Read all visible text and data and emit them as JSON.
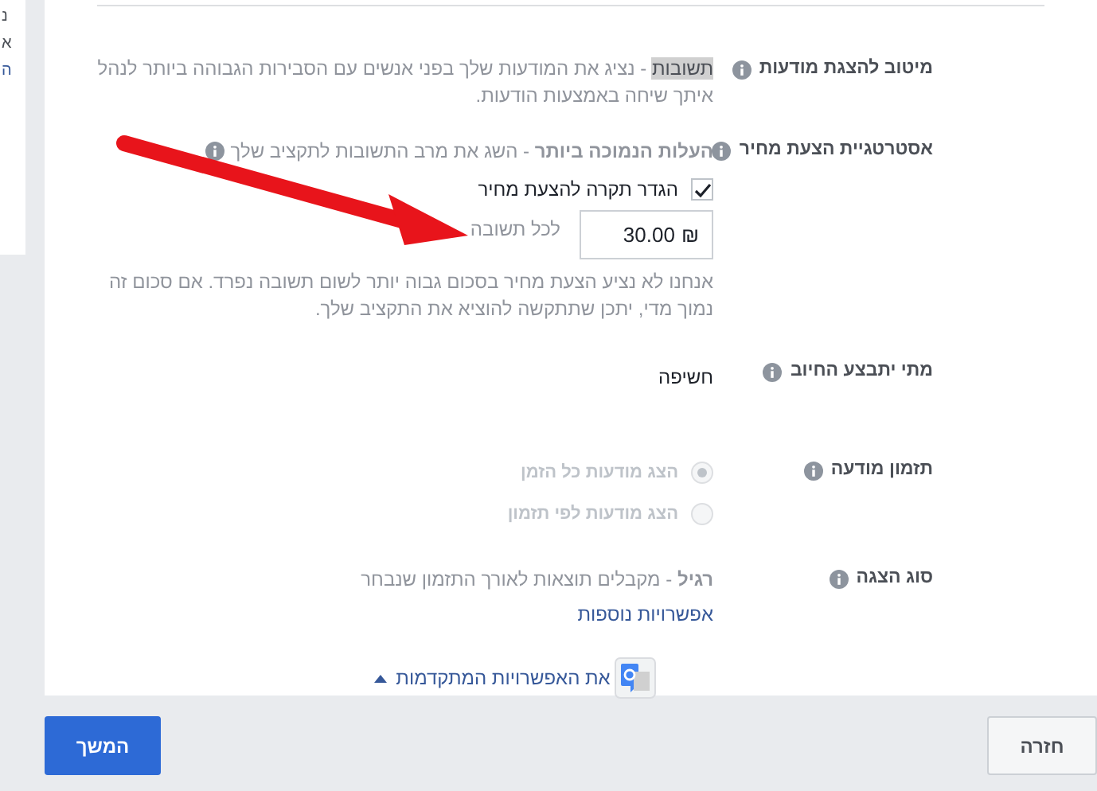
{
  "side_panel": {
    "lines": [
      {
        "text": "נ",
        "kind": "plain"
      },
      {
        "text": "א",
        "kind": "plain"
      },
      {
        "text": "ה",
        "kind": "link"
      }
    ]
  },
  "rows": [
    {
      "kind": "description",
      "label": "מיטוב להצגת מודעות",
      "term": "תשובות",
      "text": "- נציג את המודעות שלך בפני אנשים עם הסבירות הגבוהה ביותר לנהל איתך שיחה באמצעות הודעות."
    },
    {
      "kind": "bid",
      "label": "אסטרטגיית הצעת מחיר",
      "text": "**העלות הנמוכה ביותר** - השג את מרב התשובות לתקציב שלך",
      "cap": {
        "label": "הגדר תקרה להצעת מחיר",
        "checked": true
      },
      "amount": {
        "value": "30.00",
        "currency": "₪",
        "unit": "לכל תשובה"
      },
      "help": "אנחנו לא נציע הצעת מחיר בסכום גבוה יותר לשום תשובה נפרד. אם סכום זה נמוך מדי, יתכן שתתקשה להוציא את התקציב שלך."
    },
    {
      "kind": "value",
      "label": "מתי יתבצע החיוב",
      "text": "חשיפה"
    },
    {
      "kind": "radios",
      "label": "תזמון מודעה",
      "options": [
        {
          "label": "הצג מודעות כל הזמן",
          "selected": true,
          "disabled": true
        },
        {
          "label": "הצג מודעות לפי תזמון",
          "selected": false,
          "disabled": true
        }
      ]
    },
    {
      "kind": "delivery",
      "label": "סוג הצגה",
      "text": "**רגיל** - מקבלים תוצאות לאורך התזמון שנבחר",
      "link": "אפשרויות נוספות"
    }
  ],
  "advanced_link": "את האפשרויות המתקדמות",
  "buttons": {
    "back": "חזרה",
    "continue": "המשך"
  }
}
